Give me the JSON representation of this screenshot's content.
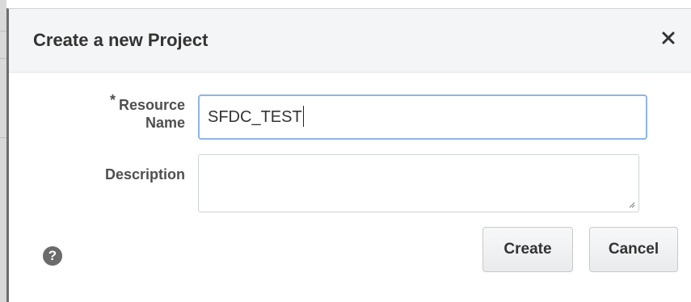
{
  "dialog": {
    "title": "Create a new Project",
    "close_icon": "close-icon"
  },
  "form": {
    "required_marker": "*",
    "resource_name": {
      "label_line1": "Resource",
      "label_line2": "Name",
      "value": "SFDC_TEST"
    },
    "description": {
      "label": "Description",
      "value": ""
    }
  },
  "footer": {
    "help_icon": "help-icon",
    "help_glyph": "?",
    "create_label": "Create",
    "cancel_label": "Cancel"
  }
}
